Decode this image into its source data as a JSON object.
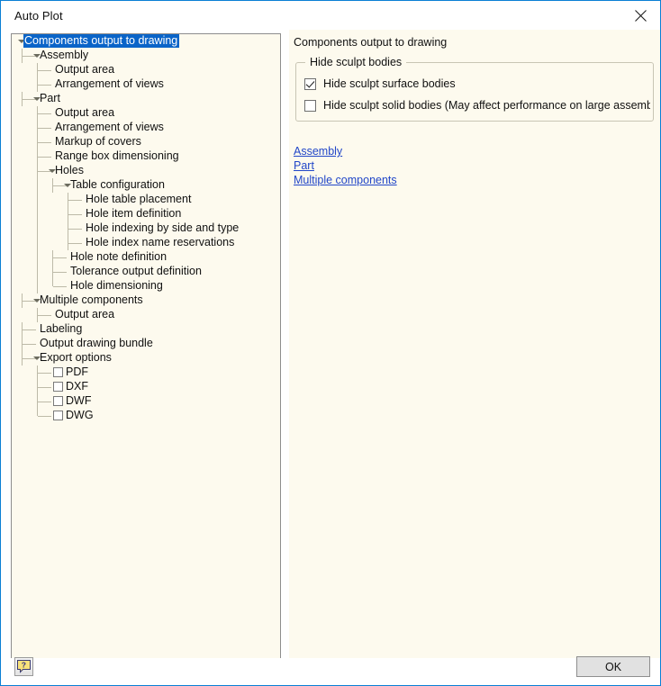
{
  "window": {
    "title": "Auto Plot",
    "close_icon": "close-icon"
  },
  "tree": {
    "nodes": [
      {
        "label": "Components output to drawing",
        "depth": 0,
        "expander": true,
        "selected": true
      },
      {
        "label": "Assembly",
        "depth": 1,
        "expander": true,
        "selected": false
      },
      {
        "label": "Output area",
        "depth": 2,
        "expander": false,
        "selected": false
      },
      {
        "label": "Arrangement of views",
        "depth": 2,
        "expander": false,
        "selected": false,
        "last": true
      },
      {
        "label": "Part",
        "depth": 1,
        "expander": true,
        "selected": false
      },
      {
        "label": "Output area",
        "depth": 2,
        "expander": false,
        "selected": false
      },
      {
        "label": "Arrangement of views",
        "depth": 2,
        "expander": false,
        "selected": false
      },
      {
        "label": "Markup of covers",
        "depth": 2,
        "expander": false,
        "selected": false
      },
      {
        "label": "Range box dimensioning",
        "depth": 2,
        "expander": false,
        "selected": false
      },
      {
        "label": "Holes",
        "depth": 2,
        "expander": true,
        "selected": false
      },
      {
        "label": "Table configuration",
        "depth": 3,
        "expander": true,
        "selected": false
      },
      {
        "label": "Hole table placement",
        "depth": 4,
        "expander": false,
        "selected": false
      },
      {
        "label": "Hole item definition",
        "depth": 4,
        "expander": false,
        "selected": false
      },
      {
        "label": "Hole indexing by side and type",
        "depth": 4,
        "expander": false,
        "selected": false
      },
      {
        "label": "Hole index name reservations",
        "depth": 4,
        "expander": false,
        "selected": false,
        "last": true
      },
      {
        "label": "Hole note definition",
        "depth": 3,
        "expander": false,
        "selected": false
      },
      {
        "label": "Tolerance output definition",
        "depth": 3,
        "expander": false,
        "selected": false
      },
      {
        "label": "Hole dimensioning",
        "depth": 3,
        "expander": false,
        "selected": false,
        "last": true
      },
      {
        "label": "Multiple components",
        "depth": 1,
        "expander": true,
        "selected": false
      },
      {
        "label": "Output area",
        "depth": 2,
        "expander": false,
        "selected": false,
        "last": true
      },
      {
        "label": "Labeling",
        "depth": 1,
        "expander": false,
        "selected": false
      },
      {
        "label": "Output drawing bundle",
        "depth": 1,
        "expander": false,
        "selected": false
      },
      {
        "label": "Export options",
        "depth": 1,
        "expander": true,
        "selected": false
      },
      {
        "label": "PDF",
        "depth": 2,
        "expander": false,
        "selected": false,
        "checkbox": true,
        "checked": false
      },
      {
        "label": "DXF",
        "depth": 2,
        "expander": false,
        "selected": false,
        "checkbox": true,
        "checked": false
      },
      {
        "label": "DWF",
        "depth": 2,
        "expander": false,
        "selected": false,
        "checkbox": true,
        "checked": false
      },
      {
        "label": "DWG",
        "depth": 2,
        "expander": false,
        "selected": false,
        "checkbox": true,
        "checked": false,
        "last": true
      }
    ]
  },
  "panel": {
    "heading": "Components output to drawing",
    "group": {
      "title": "Hide sculpt bodies",
      "options": [
        {
          "label": "Hide sculpt surface bodies",
          "checked": true
        },
        {
          "label": "Hide sculpt solid bodies (May affect performance on large assemb",
          "checked": false
        }
      ]
    },
    "links": [
      {
        "label": "Assembly"
      },
      {
        "label": "Part"
      },
      {
        "label": "Multiple components"
      }
    ]
  },
  "footer": {
    "help_icon": "help-icon",
    "ok_label": "OK"
  },
  "colors": {
    "window_border": "#0a7fd4",
    "panel_background": "#fdfaee",
    "selection": "#0a64c8",
    "link": "#2146c8",
    "tree_line": "#bdbaa8"
  }
}
